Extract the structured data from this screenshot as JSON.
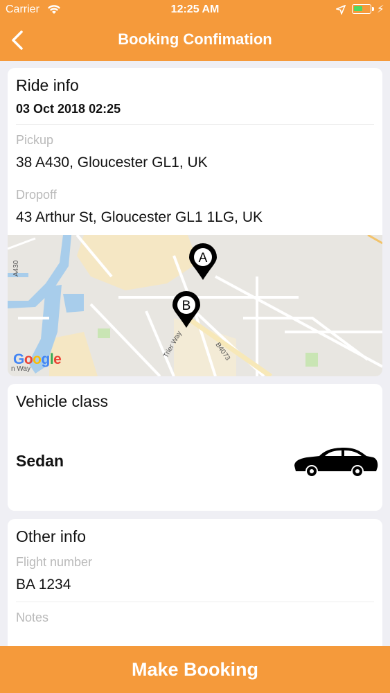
{
  "status_bar": {
    "carrier": "Carrier",
    "time": "12:25 AM",
    "battery_level": 0.55,
    "battery_color": "#4cd964"
  },
  "header": {
    "title": "Booking Confimation",
    "back_icon": "chevron-left-icon",
    "color": "#f59a3b"
  },
  "ride_info": {
    "title": "Ride info",
    "datetime": "03 Oct 2018 02:25",
    "pickup_label": "Pickup",
    "pickup_value": "38 A430, Gloucester GL1, UK",
    "dropoff_label": "Dropoff",
    "dropoff_value": "43 Arthur St, Gloucester GL1 1LG, UK"
  },
  "map": {
    "marker_a": "A",
    "marker_b": "B",
    "road_labels": [
      "A430",
      "Trier Way",
      "B4073"
    ],
    "way_label": "n Way",
    "logo": [
      "G",
      "o",
      "o",
      "g",
      "l",
      "e"
    ],
    "logo_colors": [
      "#4285f4",
      "#ea4335",
      "#fbbc05",
      "#4285f4",
      "#34a853",
      "#ea4335"
    ]
  },
  "vehicle": {
    "title": "Vehicle class",
    "name": "Sedan",
    "icon": "car-icon"
  },
  "other_info": {
    "title": "Other info",
    "flight_label": "Flight number",
    "flight_value": "BA 1234",
    "notes_label": "Notes"
  },
  "footer": {
    "button_label": "Make Booking"
  }
}
